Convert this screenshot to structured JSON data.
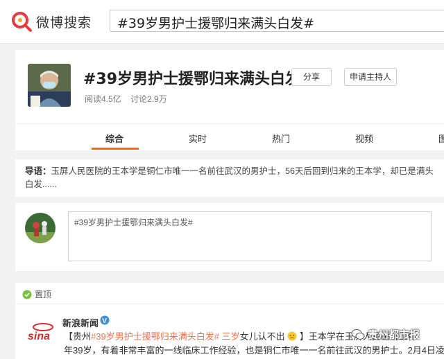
{
  "header": {
    "logo_text": "微博搜索",
    "search_value": "#39岁男护士援鄂归来满头白发#"
  },
  "topic": {
    "title": "#39岁男护士援鄂归来满头白发#",
    "share_label": "分享",
    "apply_host_label": "申请主持人",
    "read_count": "阅读4.5亿",
    "discuss_count": "讨论2.9万"
  },
  "tabs": [
    {
      "label": "综合"
    },
    {
      "label": "实时"
    },
    {
      "label": "热门"
    },
    {
      "label": "视频"
    },
    {
      "label": "图"
    }
  ],
  "intro": {
    "label": "导语：",
    "text": "玉屏人民医院的王本学是铜仁市唯一一名前往武汉的男护士，56天后回到归来的王本学，却已是满头白发......"
  },
  "composer": {
    "text": "#39岁男护士援鄂归来满头白发#"
  },
  "feed": {
    "pin_label": "置顶",
    "author": "新浪新闻",
    "bracket_open": "【贵州",
    "topic_link": "#39岁男护士援鄂归来满头白发#",
    "sub_link": "三岁",
    "line1_tail": "女儿认不出",
    "line1_rest": "】王本学在玉屏人民医院工作",
    "line2": "年39岁，有着非常丰富的一线临床工作经验，也是铜仁市唯一一名前往武汉的男护士。2月4日凌"
  },
  "watermark": {
    "text": "贵州都市报"
  },
  "colors": {
    "accent": "#ff6600",
    "link": "#eb7350"
  }
}
